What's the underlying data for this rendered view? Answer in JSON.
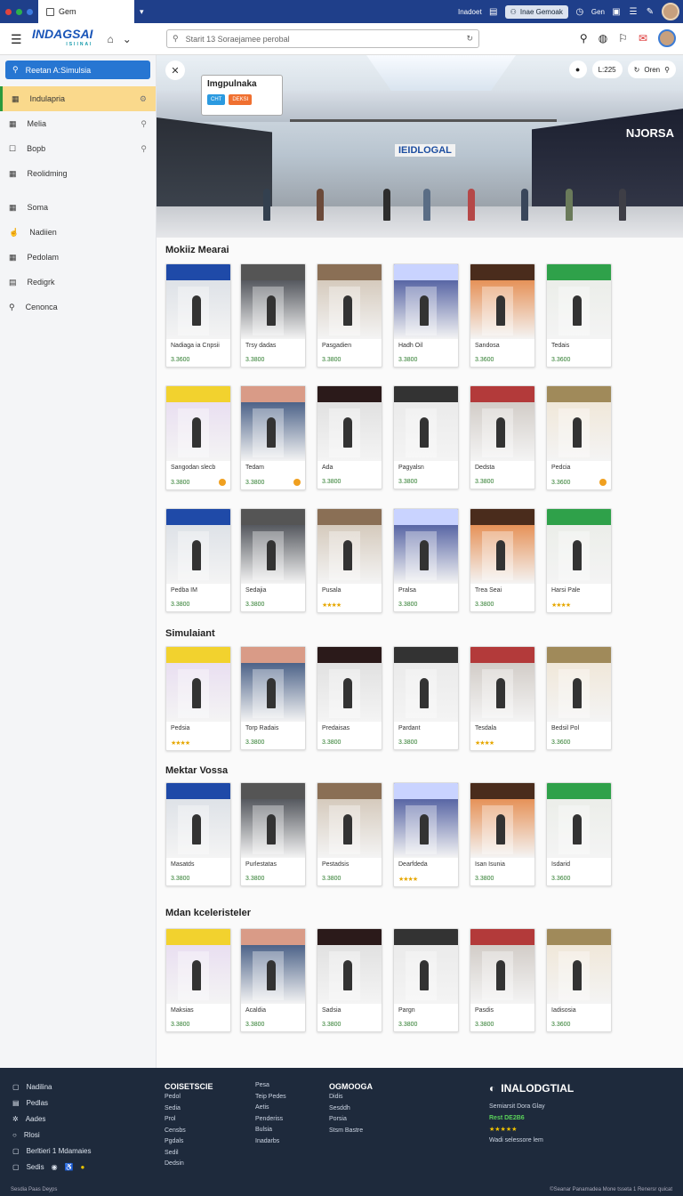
{
  "browser": {
    "tab_title": "Gem",
    "right_label": "Inadoet",
    "button_label": "Inae Gemoak",
    "gem_label": "Gen",
    "accent": "#1f3f8a"
  },
  "toolbar": {
    "logo_main": "INDAGSAI",
    "logo_sub": "ISIINAI",
    "search_placeholder": "Starit 13 Soraejamee perobal"
  },
  "sidebar": {
    "search_label": "Reetan A:Simulsia",
    "items": [
      {
        "label": "Indulapria",
        "icon": "calendar-icon"
      },
      {
        "label": "Melia",
        "icon": "calendar-icon"
      },
      {
        "label": "Bopb",
        "icon": "checkbox-icon"
      },
      {
        "label": "Reolidming",
        "icon": "calendar-icon"
      },
      {
        "label": "Soma",
        "icon": "calendar-icon"
      },
      {
        "label": "Nadiien",
        "icon": "thumb-icon"
      },
      {
        "label": "Pedolam",
        "icon": "calendar-icon"
      },
      {
        "label": "Redigrk",
        "icon": "list-icon"
      },
      {
        "label": "Cenonca",
        "icon": "search-icon"
      }
    ]
  },
  "hero": {
    "popup_title": "Imgpulnaka",
    "popup_btn1": "CHT",
    "popup_btn2": "DEKSI",
    "sign_center": "IEIDLOGAL",
    "sign_right": "NJORSA",
    "pill_time": "L:225",
    "pill_open": "Oren"
  },
  "sections": [
    {
      "title": "Mokiiz Mearai",
      "rows": [
        [
          {
            "name": "Nadiaga ia Cnpsii",
            "price": "3.3600",
            "stars": false,
            "badge": false
          },
          {
            "name": "Trsy dadas",
            "price": "3.3800",
            "stars": false,
            "badge": false
          },
          {
            "name": "Pasgadien",
            "price": "3.3800",
            "stars": false,
            "badge": false
          },
          {
            "name": "Hadh Oil",
            "price": "3.3800",
            "stars": false,
            "badge": false
          },
          {
            "name": "Sandosa",
            "price": "3.3600",
            "stars": false,
            "badge": false
          },
          {
            "name": "Tedais",
            "price": "3.3600",
            "stars": false,
            "badge": false
          }
        ],
        [
          {
            "name": "Sangodan slecb",
            "price": "3.3800",
            "stars": false,
            "badge": true
          },
          {
            "name": "Tedam",
            "price": "3.3800",
            "stars": false,
            "badge": true
          },
          {
            "name": "Ada",
            "price": "3.3800",
            "stars": false,
            "badge": false
          },
          {
            "name": "Pagyalsn",
            "price": "3.3800",
            "stars": false,
            "badge": false
          },
          {
            "name": "Dedsta",
            "price": "3.3800",
            "stars": false,
            "badge": false
          },
          {
            "name": "Pedcia",
            "price": "3.3600",
            "stars": false,
            "badge": true
          }
        ],
        [
          {
            "name": "Pedba IM",
            "price": "3.3800",
            "stars": false,
            "badge": false
          },
          {
            "name": "Sedajia",
            "price": "3.3800",
            "stars": false,
            "badge": false
          },
          {
            "name": "Pusala",
            "price": "★★★★",
            "stars": true,
            "badge": false
          },
          {
            "name": "Pralsa",
            "price": "3.3800",
            "stars": false,
            "badge": false
          },
          {
            "name": "Trea Seai",
            "price": "3.3800",
            "stars": false,
            "badge": false
          },
          {
            "name": "Harsi Pale",
            "price": "★★★★",
            "stars": true,
            "badge": false
          }
        ]
      ]
    },
    {
      "title": "Simulaiant",
      "rows": [
        [
          {
            "name": "Pedsia",
            "price": "★★★★",
            "stars": true,
            "badge": false
          },
          {
            "name": "Torp Radais",
            "price": "3.3800",
            "stars": false,
            "badge": false
          },
          {
            "name": "Predaisas",
            "price": "3.3800",
            "stars": false,
            "badge": false
          },
          {
            "name": "Pardant",
            "price": "3.3800",
            "stars": false,
            "badge": false
          },
          {
            "name": "Tesdala",
            "price": "★★★★",
            "stars": true,
            "badge": false
          },
          {
            "name": "Bedsil Pol",
            "price": "3.3600",
            "stars": false,
            "badge": false
          }
        ]
      ]
    },
    {
      "title": "Mektar Vossa",
      "rows": [
        [
          {
            "name": "Masatds",
            "price": "3.3800",
            "stars": false,
            "badge": false
          },
          {
            "name": "Purlestatas",
            "price": "3.3800",
            "stars": false,
            "badge": false
          },
          {
            "name": "Pestadsis",
            "price": "3.3800",
            "stars": false,
            "badge": false
          },
          {
            "name": "Dearfdeda",
            "price": "★★★★",
            "stars": true,
            "badge": false
          },
          {
            "name": "Isan Isunia",
            "price": "3.3800",
            "stars": false,
            "badge": false
          },
          {
            "name": "Isdarid",
            "price": "3.3600",
            "stars": false,
            "badge": false
          }
        ]
      ]
    },
    {
      "title": "Mdan kceleristeler",
      "rows": [
        [
          {
            "name": "Maksias",
            "price": "3.3800",
            "stars": false,
            "badge": false
          },
          {
            "name": "Acaldia",
            "price": "3.3800",
            "stars": false,
            "badge": false
          },
          {
            "name": "Sadsia",
            "price": "3.3800",
            "stars": false,
            "badge": false
          },
          {
            "name": "Pargn",
            "price": "3.3800",
            "stars": false,
            "badge": false
          },
          {
            "name": "Pasdis",
            "price": "3.3800",
            "stars": false,
            "badge": false
          },
          {
            "name": "Iadisosia",
            "price": "3.3600",
            "stars": false,
            "badge": false
          }
        ]
      ]
    }
  ],
  "footer": {
    "left_items": [
      "Nadilina",
      "Pedlas",
      "Aades",
      "Rlosi",
      "Berltieri 1 Mdamaies",
      "Sedis"
    ],
    "col1_head": "COISETSCIE",
    "col1_links": [
      "Pedol",
      "Sedia",
      "Prol",
      "Censbs",
      "Pgdals",
      "Sedil",
      "Dedsin"
    ],
    "col2_links": [
      "Pesa",
      "Teip Pedes",
      "Aetis",
      "Penderiss",
      "Bulsia",
      "Inadarbs"
    ],
    "col3_head": "OGMOOGA",
    "col3_links": [
      "Didis",
      "Sesddh",
      "Porsia",
      "Stsm Bastre"
    ],
    "brand": "INALODGTIAL",
    "brand_line": "Semiarsit Dora Glay",
    "brand_highlight": "Rest DE2B6",
    "brand_stars": "★★★★★",
    "brand_note": "Wadi selessore lem",
    "bottom_left": "Sesdia Paas Deyps",
    "bottom_right": "©Seanar Panamadea Mone tsseta 1 Renersr quicat"
  }
}
